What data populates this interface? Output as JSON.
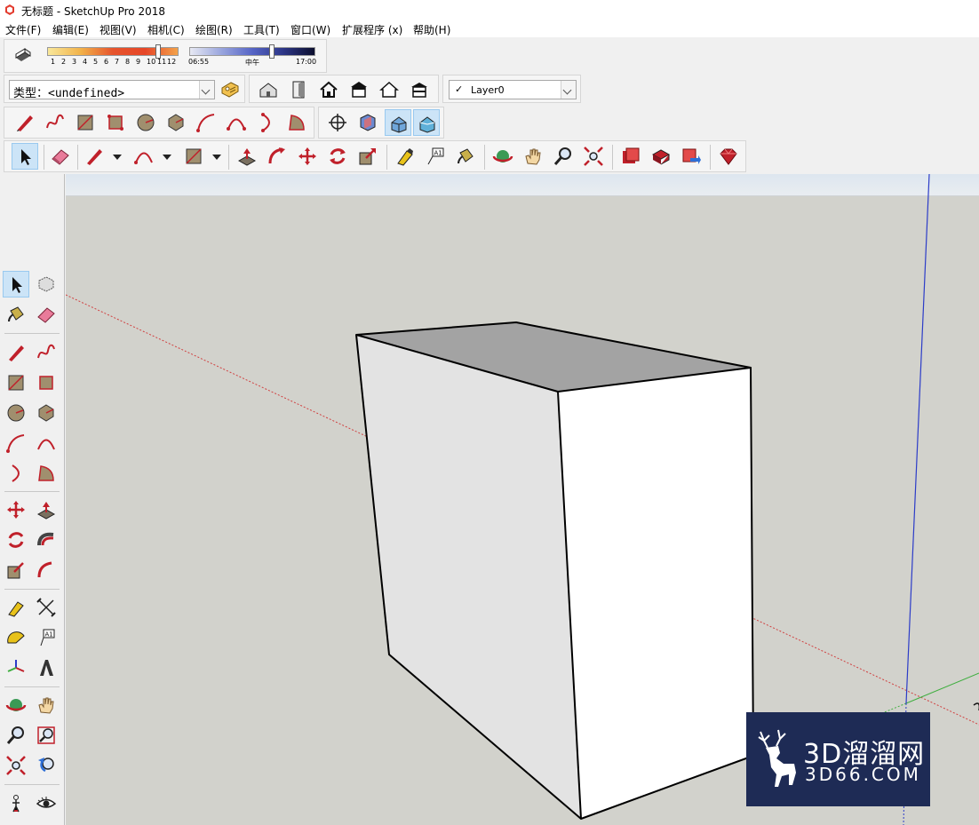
{
  "window": {
    "title": "无标题 - SketchUp Pro 2018"
  },
  "menu": [
    "文件(F)",
    "编辑(E)",
    "视图(V)",
    "相机(C)",
    "绘图(R)",
    "工具(T)",
    "窗口(W)",
    "扩展程序 (x)",
    "帮助(H)"
  ],
  "shadows": {
    "month_labels": [
      "1",
      "2",
      "3",
      "4",
      "5",
      "6",
      "7",
      "8",
      "9",
      "10",
      "11",
      "12"
    ],
    "time_start": "06:55",
    "time_noon": "中午",
    "time_end": "17:00"
  },
  "style_picker": {
    "value": "类型：<undefined>"
  },
  "layer_picker": {
    "check": "✓",
    "value": "Layer0"
  },
  "watermark": {
    "brand": "3D溜溜网",
    "domain": "3D66.COM"
  },
  "colors": {
    "accent_red": "#c0202a",
    "axis_blue": "#2c3cc8",
    "axis_green": "#3fae3f",
    "viewport_bg": "#d2d2cc",
    "watermark_bg": "#1e2b55"
  }
}
